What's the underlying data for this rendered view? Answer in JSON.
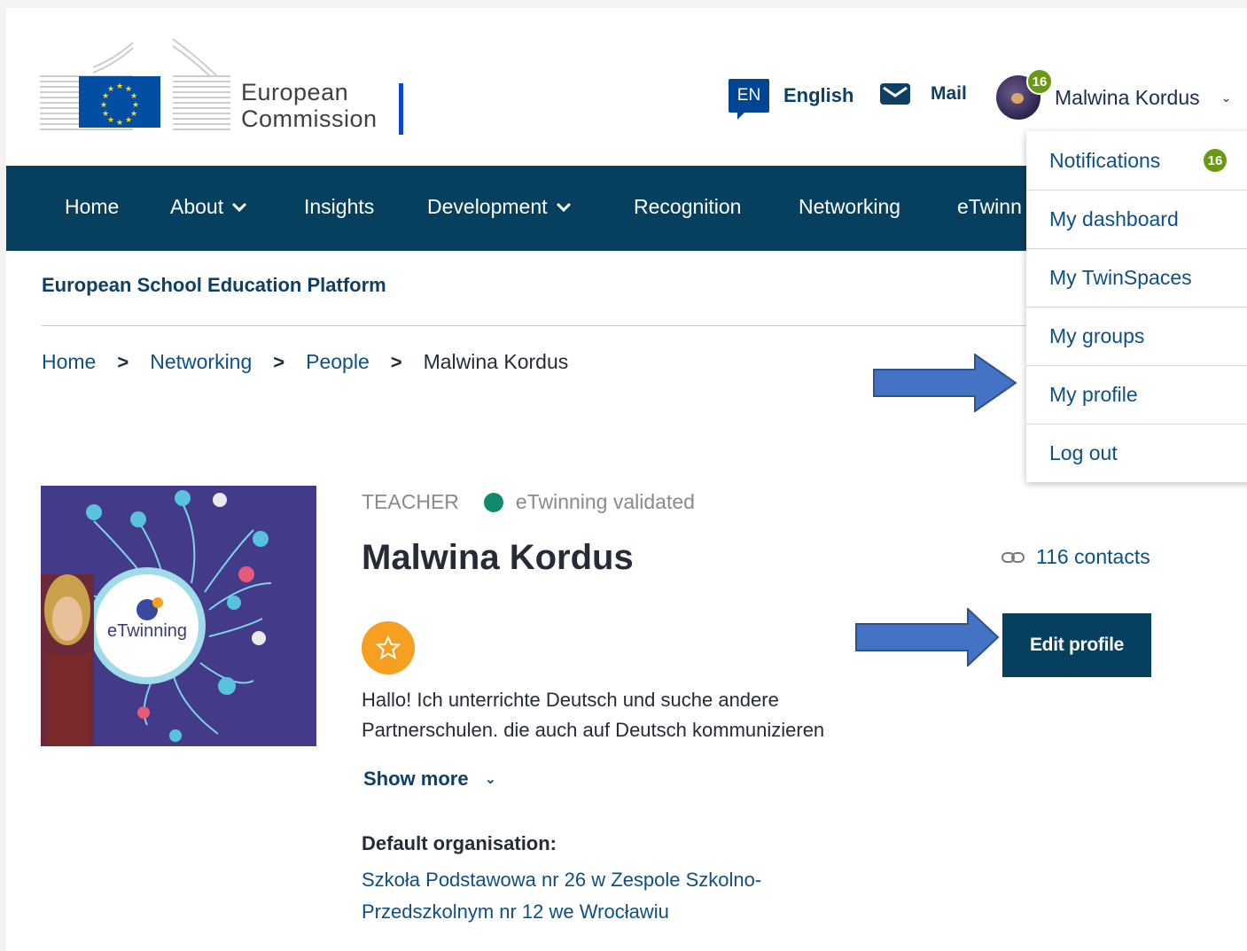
{
  "header": {
    "logo_line1": "European",
    "logo_line2": "Commission",
    "language_code": "EN",
    "language_name": "English",
    "mail_label": "Mail",
    "user_name": "Malwina Kordus",
    "notification_count": "16"
  },
  "nav": {
    "items": [
      "Home",
      "About",
      "Insights",
      "Development",
      "Recognition",
      "Networking",
      "eTwinn"
    ]
  },
  "site_name": "European School Education Platform",
  "breadcrumb": [
    "Home",
    "Networking",
    "People",
    "Malwina Kordus"
  ],
  "dropdown": {
    "items": [
      "Notifications",
      "My dashboard",
      "My TwinSpaces",
      "My groups",
      "My profile",
      "Log out"
    ],
    "notifications_badge": "16"
  },
  "profile": {
    "role": "TEACHER",
    "status": "eTwinning validated",
    "name": "Malwina Kordus",
    "contacts": "116 contacts",
    "edit_label": "Edit profile",
    "bio": "Hallo! Ich unterrichte Deutsch und suche andere Partnerschulen, die auch auf Deutsch kommunizieren",
    "show_more": "Show more",
    "org_label": "Default organisation:",
    "org_name": "Szkoła Podstawowa nr 26 w Zespole Szkolno-Przedszkolnym nr 12 we Wrocławiu",
    "photo_text": "eTwinning"
  },
  "colors": {
    "nav_bg": "#07405f",
    "link": "#0e4f86",
    "badge_green": "#6a9a14",
    "arrow_blue": "#4472c4",
    "status_green": "#0f8a6f",
    "star_orange": "#f5a021"
  }
}
